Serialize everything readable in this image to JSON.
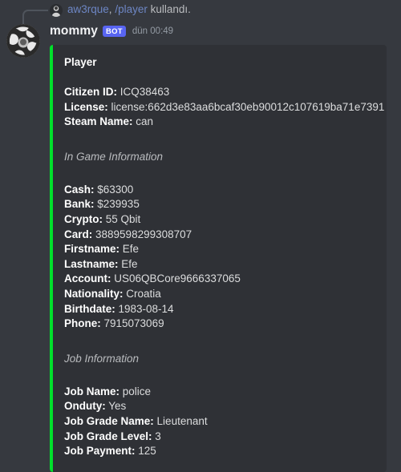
{
  "reply": {
    "avatar_icon": "user-avatar-small",
    "user": "aw3rque",
    "separator": ", ",
    "command": "/player",
    "trailing": " kullandı."
  },
  "message": {
    "avatar_icon": "bot-avatar",
    "author": "mommy",
    "bot_badge": "BOT",
    "timestamp": "dün 00:49"
  },
  "embed": {
    "accent_color": "#00e02b",
    "background_color": "#2f3136",
    "title": "Player",
    "top_fields": [
      {
        "key": "Citizen ID:",
        "value": "ICQ38463"
      },
      {
        "key": "License:",
        "value": "license:662d3e83aa6bcaf30eb90012c107619ba71e7391"
      },
      {
        "key": "Steam Name:",
        "value": "can"
      }
    ],
    "sections": [
      {
        "heading": "In Game Information",
        "fields": [
          {
            "key": "Cash:",
            "value": "$63300"
          },
          {
            "key": "Bank:",
            "value": "$239935"
          },
          {
            "key": "Crypto:",
            "value": "55 Qbit"
          },
          {
            "key": "Card:",
            "value": "3889598299308707"
          },
          {
            "key": "Firstname:",
            "value": "Efe"
          },
          {
            "key": "Lastname:",
            "value": "Efe"
          },
          {
            "key": "Account:",
            "value": "US06QBCore9666337065"
          },
          {
            "key": "Nationality:",
            "value": "Croatia"
          },
          {
            "key": "Birthdate:",
            "value": "1983-08-14"
          },
          {
            "key": "Phone:",
            "value": "7915073069"
          }
        ]
      },
      {
        "heading": "Job Information",
        "fields": [
          {
            "key": "Job Name:",
            "value": "police"
          },
          {
            "key": "Onduty:",
            "value": "Yes"
          },
          {
            "key": "Job Grade Name:",
            "value": "Lieutenant"
          },
          {
            "key": "Job Grade Level:",
            "value": "3"
          },
          {
            "key": "Job Payment:",
            "value": "125"
          }
        ]
      }
    ]
  }
}
